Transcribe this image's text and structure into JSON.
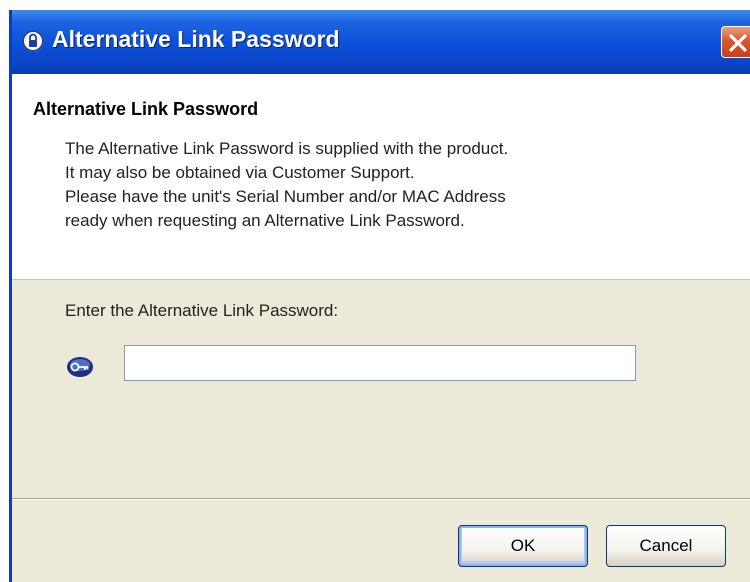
{
  "window": {
    "title": "Alternative Link Password",
    "title_icon": "password-shield-icon",
    "close_icon": "close-icon",
    "titlebar_color": "#0a4fd8",
    "close_color": "#d9572f"
  },
  "header": {
    "title": "Alternative Link Password",
    "description_lines": [
      "The Alternative Link Password is supplied with the product.",
      "It may also be obtained via Customer Support.",
      "Please have the unit's Serial Number and/or MAC Address",
      "ready when requesting an Alternative Link Password."
    ]
  },
  "form": {
    "prompt": "Enter the Alternative Link Password:",
    "key_icon": "key-icon",
    "password_value": "",
    "password_placeholder": ""
  },
  "buttons": {
    "ok_label": "OK",
    "cancel_label": "Cancel"
  }
}
